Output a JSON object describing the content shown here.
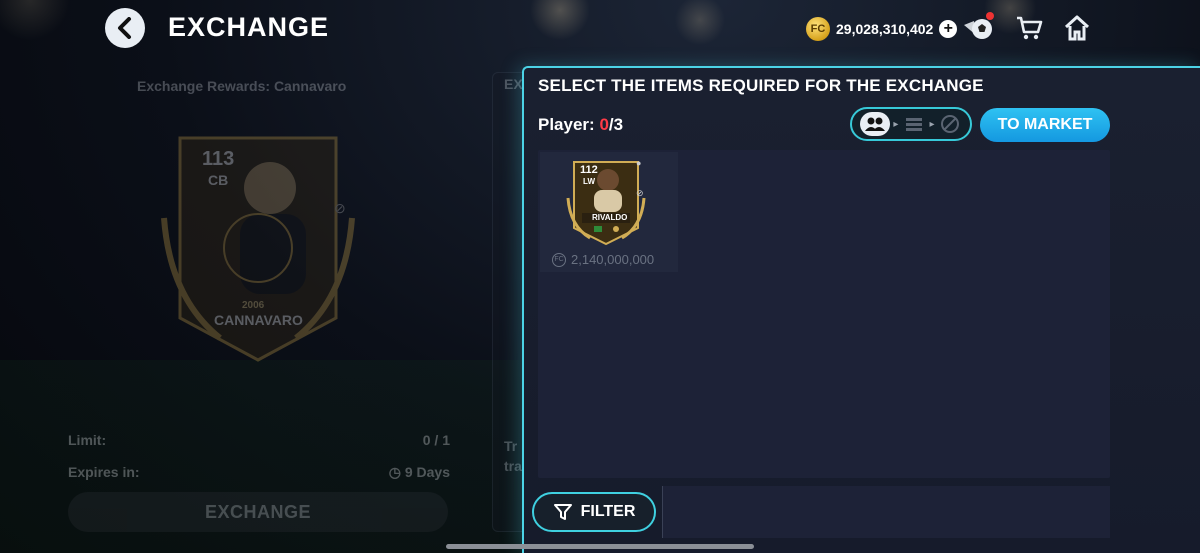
{
  "header": {
    "title": "EXCHANGE",
    "coins": "29,028,310,402"
  },
  "left_panel": {
    "rewards_label": "Exchange Rewards:  Cannavaro",
    "reward_card": {
      "rating": "113",
      "position": "CB",
      "year": "2006",
      "name": "CANNAVARO"
    },
    "limit_label": "Limit:",
    "limit_value": "0 / 1",
    "expires_label": "Expires in:",
    "expires_value": "9 Days",
    "exchange_button": "EXCHANGE",
    "behind_title": "EX",
    "behind_text_1": "Tr",
    "behind_text_2": "tra"
  },
  "modal": {
    "title": "SELECT THE ITEMS REQUIRED FOR THE EXCHANGE",
    "player_label": "Player:",
    "player_current": "0",
    "player_total": "/3",
    "to_market_button": "TO MARKET",
    "filter_button": "FILTER",
    "items": [
      {
        "rating": "112",
        "position": "LW",
        "name": "RIVALDO",
        "price": "2,140,000,000"
      }
    ]
  },
  "colors": {
    "accent_cyan": "#4cd3e6",
    "market_blue": "#1ea8ea",
    "count_red": "#ff3b47",
    "gold": "#c9a24a"
  }
}
